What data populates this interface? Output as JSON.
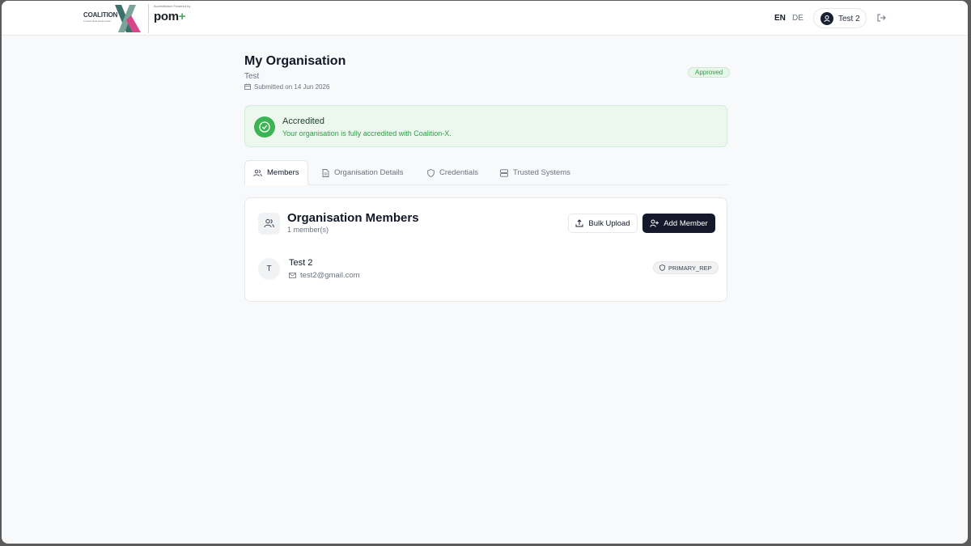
{
  "header": {
    "logo_text": "COALITION",
    "logo_sub": "Trusted Real Estate Data",
    "powered_by": "Accreditation Powered by",
    "pom_text": "pom",
    "pom_plus": "+",
    "lang_en": "EN",
    "lang_de": "DE",
    "user_name": "Test 2",
    "logout_icon": "logout-icon"
  },
  "page": {
    "title": "My Organisation",
    "subtitle": "Test",
    "submitted": "Submitted on 14 Jun 2026",
    "status_badge": "Approved"
  },
  "accredited": {
    "title": "Accredited",
    "description": "Your organisation is fully accredited with Coalition-X."
  },
  "tabs": [
    {
      "label": "Members",
      "icon": "users-icon"
    },
    {
      "label": "Organisation Details",
      "icon": "document-icon"
    },
    {
      "label": "Credentials",
      "icon": "shield-icon"
    },
    {
      "label": "Trusted Systems",
      "icon": "server-icon"
    }
  ],
  "members_card": {
    "title": "Organisation Members",
    "count": "1 member(s)",
    "bulk_upload": "Bulk Upload",
    "add_member": "Add Member",
    "members": [
      {
        "initial": "T",
        "name": "Test 2",
        "email": "test2@gmail.com",
        "role": "PRIMARY_REP"
      }
    ]
  },
  "colors": {
    "accent_green": "#3cb454",
    "primary_dark": "#141a2b",
    "background": "#f8f9fb"
  }
}
